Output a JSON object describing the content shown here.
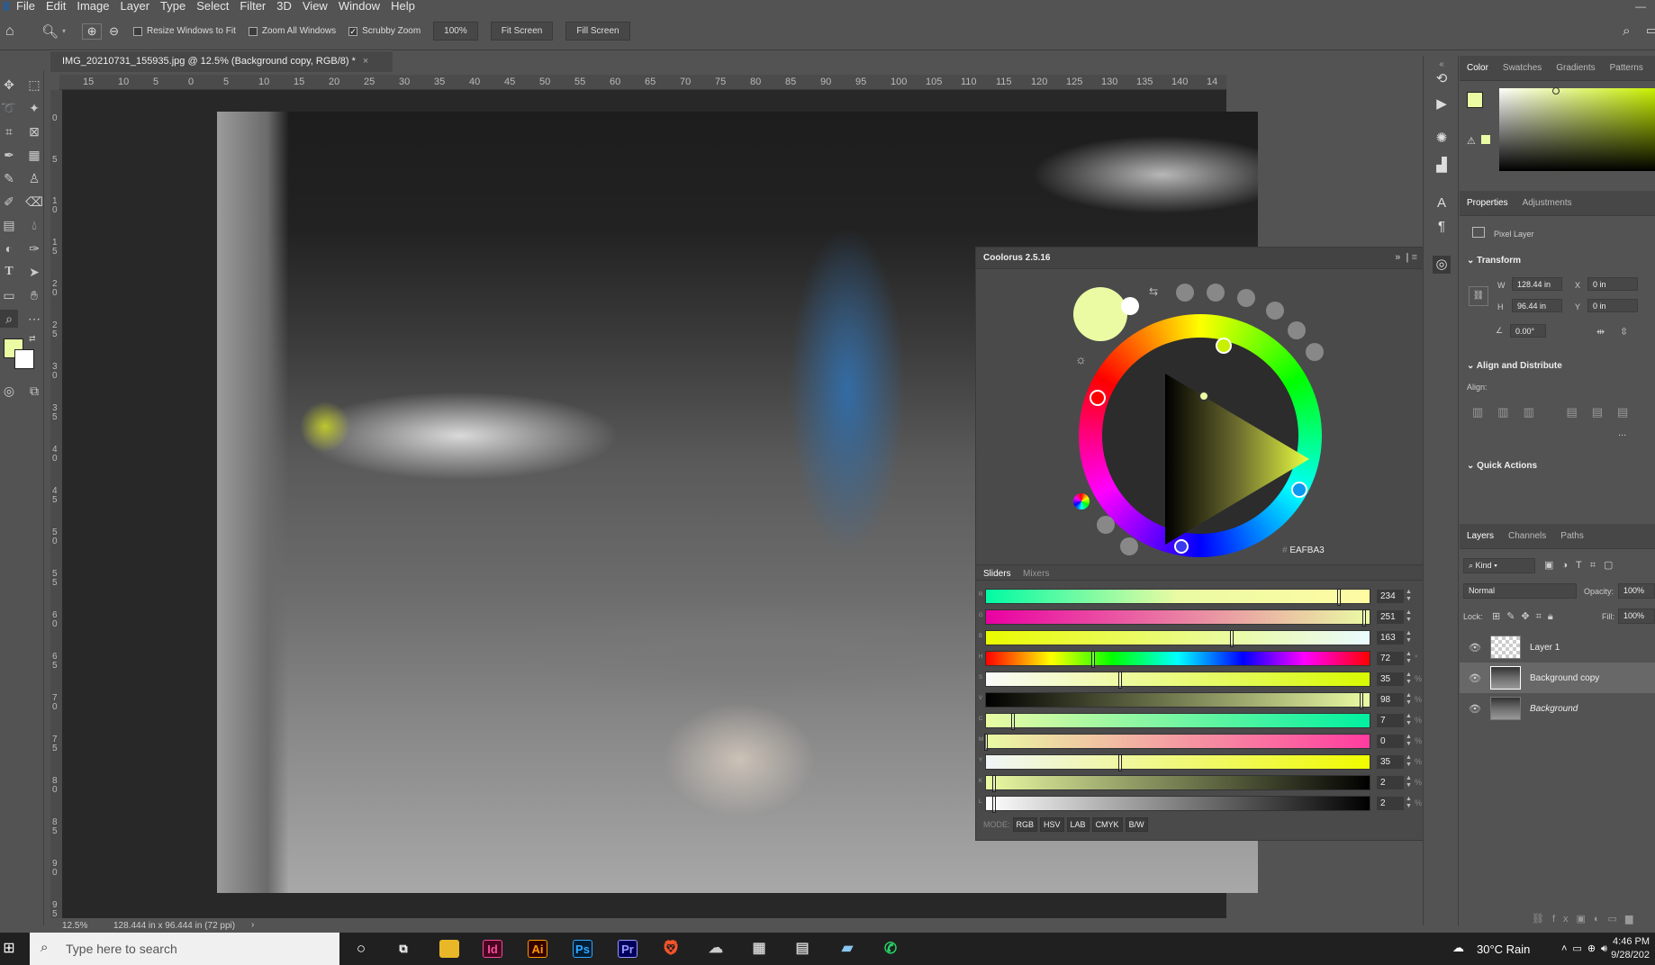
{
  "menubar": {
    "items": [
      "File",
      "Edit",
      "Image",
      "Layer",
      "Type",
      "Select",
      "Filter",
      "3D",
      "View",
      "Window",
      "Help"
    ]
  },
  "options": {
    "resize_windows": "Resize Windows to Fit",
    "zoom_all": "Zoom All Windows",
    "scrubby": "Scrubby Zoom",
    "zoom_value": "100%",
    "fit_screen": "Fit Screen",
    "fill_screen": "Fill Screen"
  },
  "document": {
    "tab_title": "IMG_20210731_155935.jpg @ 12.5% (Background copy, RGB/8) *",
    "close": "×"
  },
  "ruler": {
    "h_labels": [
      "15",
      "10",
      "5",
      "0",
      "5",
      "10",
      "15",
      "20",
      "25",
      "30",
      "35",
      "40",
      "45",
      "50",
      "55",
      "60",
      "65",
      "70",
      "75",
      "80",
      "85",
      "90",
      "95",
      "100",
      "105",
      "110",
      "115",
      "120",
      "125",
      "130",
      "135",
      "140",
      "14"
    ],
    "v_labels": [
      "0",
      "5",
      "1\n0",
      "1\n5",
      "2\n0",
      "2\n5",
      "3\n0",
      "3\n5",
      "4\n0",
      "4\n5",
      "5\n0",
      "5\n5",
      "6\n0",
      "6\n5",
      "7\n0",
      "7\n5",
      "8\n0",
      "8\n5",
      "9\n0",
      "9\n5"
    ]
  },
  "status": {
    "zoom": "12.5%",
    "size": "128.444 in x 96.444 in (72 ppi)",
    "arrow": "›"
  },
  "coolorus": {
    "title": "Coolorus 2.5.16",
    "hex": "EAFBA3",
    "tabs": [
      "Sliders",
      "Mixers"
    ],
    "sliders": [
      {
        "label": "R",
        "value": "234",
        "unit": ""
      },
      {
        "label": "G",
        "value": "251",
        "unit": ""
      },
      {
        "label": "B",
        "value": "163",
        "unit": ""
      },
      {
        "label": "H",
        "value": "72",
        "unit": "°"
      },
      {
        "label": "S",
        "value": "35",
        "unit": "%"
      },
      {
        "label": "V",
        "value": "98",
        "unit": "%"
      },
      {
        "label": "C",
        "value": "7",
        "unit": "%"
      },
      {
        "label": "M",
        "value": "0",
        "unit": "%"
      },
      {
        "label": "Y",
        "value": "35",
        "unit": "%"
      },
      {
        "label": "K",
        "value": "2",
        "unit": "%"
      },
      {
        "label": "L",
        "value": "2",
        "unit": "%"
      }
    ],
    "mode_label": "MODE:",
    "modes": [
      "RGB",
      "HSV",
      "LAB",
      "CMYK",
      "B/W"
    ],
    "fg_color": "#eafba3"
  },
  "color_panel": {
    "tabs": [
      "Color",
      "Swatches",
      "Gradients",
      "Patterns"
    ]
  },
  "properties": {
    "tabs": [
      "Properties",
      "Adjustments"
    ],
    "type": "Pixel Layer",
    "transform": "Transform",
    "w_label": "W",
    "w": "128.44 in",
    "h_label": "H",
    "h": "96.44 in",
    "x_label": "X",
    "x": "0 in",
    "y_label": "Y",
    "y": "0 in",
    "angle": "0.00°",
    "align_title": "Align and Distribute",
    "align_label": "Align:",
    "more": "...",
    "quick_actions": "Quick Actions"
  },
  "layers": {
    "tabs": [
      "Layers",
      "Channels",
      "Paths"
    ],
    "kind": "Kind",
    "blend": "Normal",
    "opacity_label": "Opacity:",
    "opacity": "100%",
    "lock_label": "Lock:",
    "fill_label": "Fill:",
    "fill": "100%",
    "items": [
      {
        "name": "Layer 1"
      },
      {
        "name": "Background copy"
      },
      {
        "name": "Background"
      }
    ]
  },
  "taskbar": {
    "search_placeholder": "Type here to search",
    "weather": "30°C  Rain",
    "time": "4:46 PM",
    "date": "9/28/202"
  }
}
